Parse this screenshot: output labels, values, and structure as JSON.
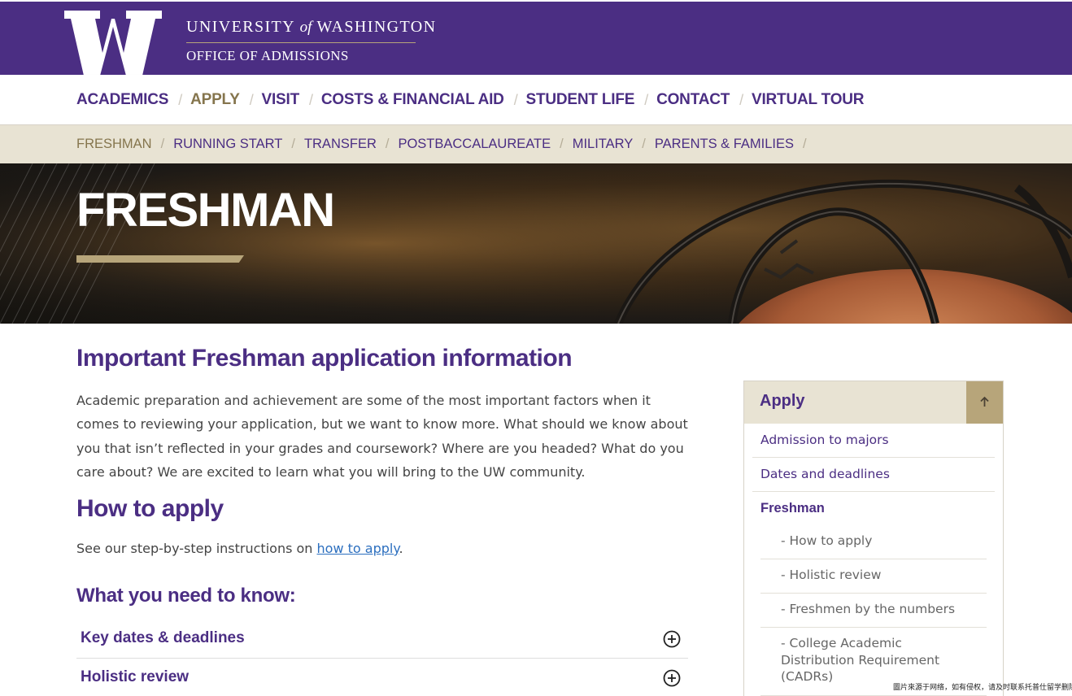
{
  "header": {
    "university_name": "UNIVERSITY",
    "university_of": "of",
    "university_name_end": "WASHINGTON",
    "office": "OFFICE OF ADMISSIONS",
    "brand_color": "#4b2e83",
    "gold_color": "#b7a57a"
  },
  "main_nav": {
    "items": [
      {
        "label": "ACADEMICS"
      },
      {
        "label": "APPLY",
        "active": true
      },
      {
        "label": "VISIT"
      },
      {
        "label": "COSTS & FINANCIAL AID"
      },
      {
        "label": "STUDENT LIFE"
      },
      {
        "label": "CONTACT"
      },
      {
        "label": "VIRTUAL TOUR"
      }
    ],
    "separator": "/"
  },
  "sub_nav": {
    "items": [
      {
        "label": "FRESHMAN",
        "active": true
      },
      {
        "label": "RUNNING START"
      },
      {
        "label": "TRANSFER"
      },
      {
        "label": "POSTBACCALAUREATE"
      },
      {
        "label": "MILITARY"
      },
      {
        "label": "PARENTS & FAMILIES"
      }
    ]
  },
  "hero": {
    "title": "FRESHMAN"
  },
  "main": {
    "heading": "Important Freshman application information",
    "intro": "Academic preparation and achievement are some of the most important factors when it comes to reviewing your application, but we want to know more. What should we know about you that isn’t reflected in your grades and coursework? Where are you headed? What do you care about? We are excited to learn what you will bring to the UW community.",
    "how_heading": "How to apply",
    "how_text_before": "See our step-by-step instructions on ",
    "how_link": "how to apply",
    "how_text_after": ".",
    "need_heading": "What you need to know:",
    "accordion": [
      {
        "label": "Key dates & deadlines"
      },
      {
        "label": "Holistic review"
      }
    ]
  },
  "sidebar": {
    "title": "Apply",
    "items": [
      {
        "label": "Admission to majors"
      },
      {
        "label": "Dates and deadlines"
      },
      {
        "label": "Freshman"
      }
    ],
    "sub_items": [
      {
        "label": "- How to apply"
      },
      {
        "label": "- Holistic review"
      },
      {
        "label": "- Freshmen by the numbers"
      },
      {
        "label": "- College Academic Distribution Requirement (CADRs)"
      }
    ]
  },
  "watermark": "圖片來源于网络，如有侵权，请及时联系托普仕留学删除"
}
